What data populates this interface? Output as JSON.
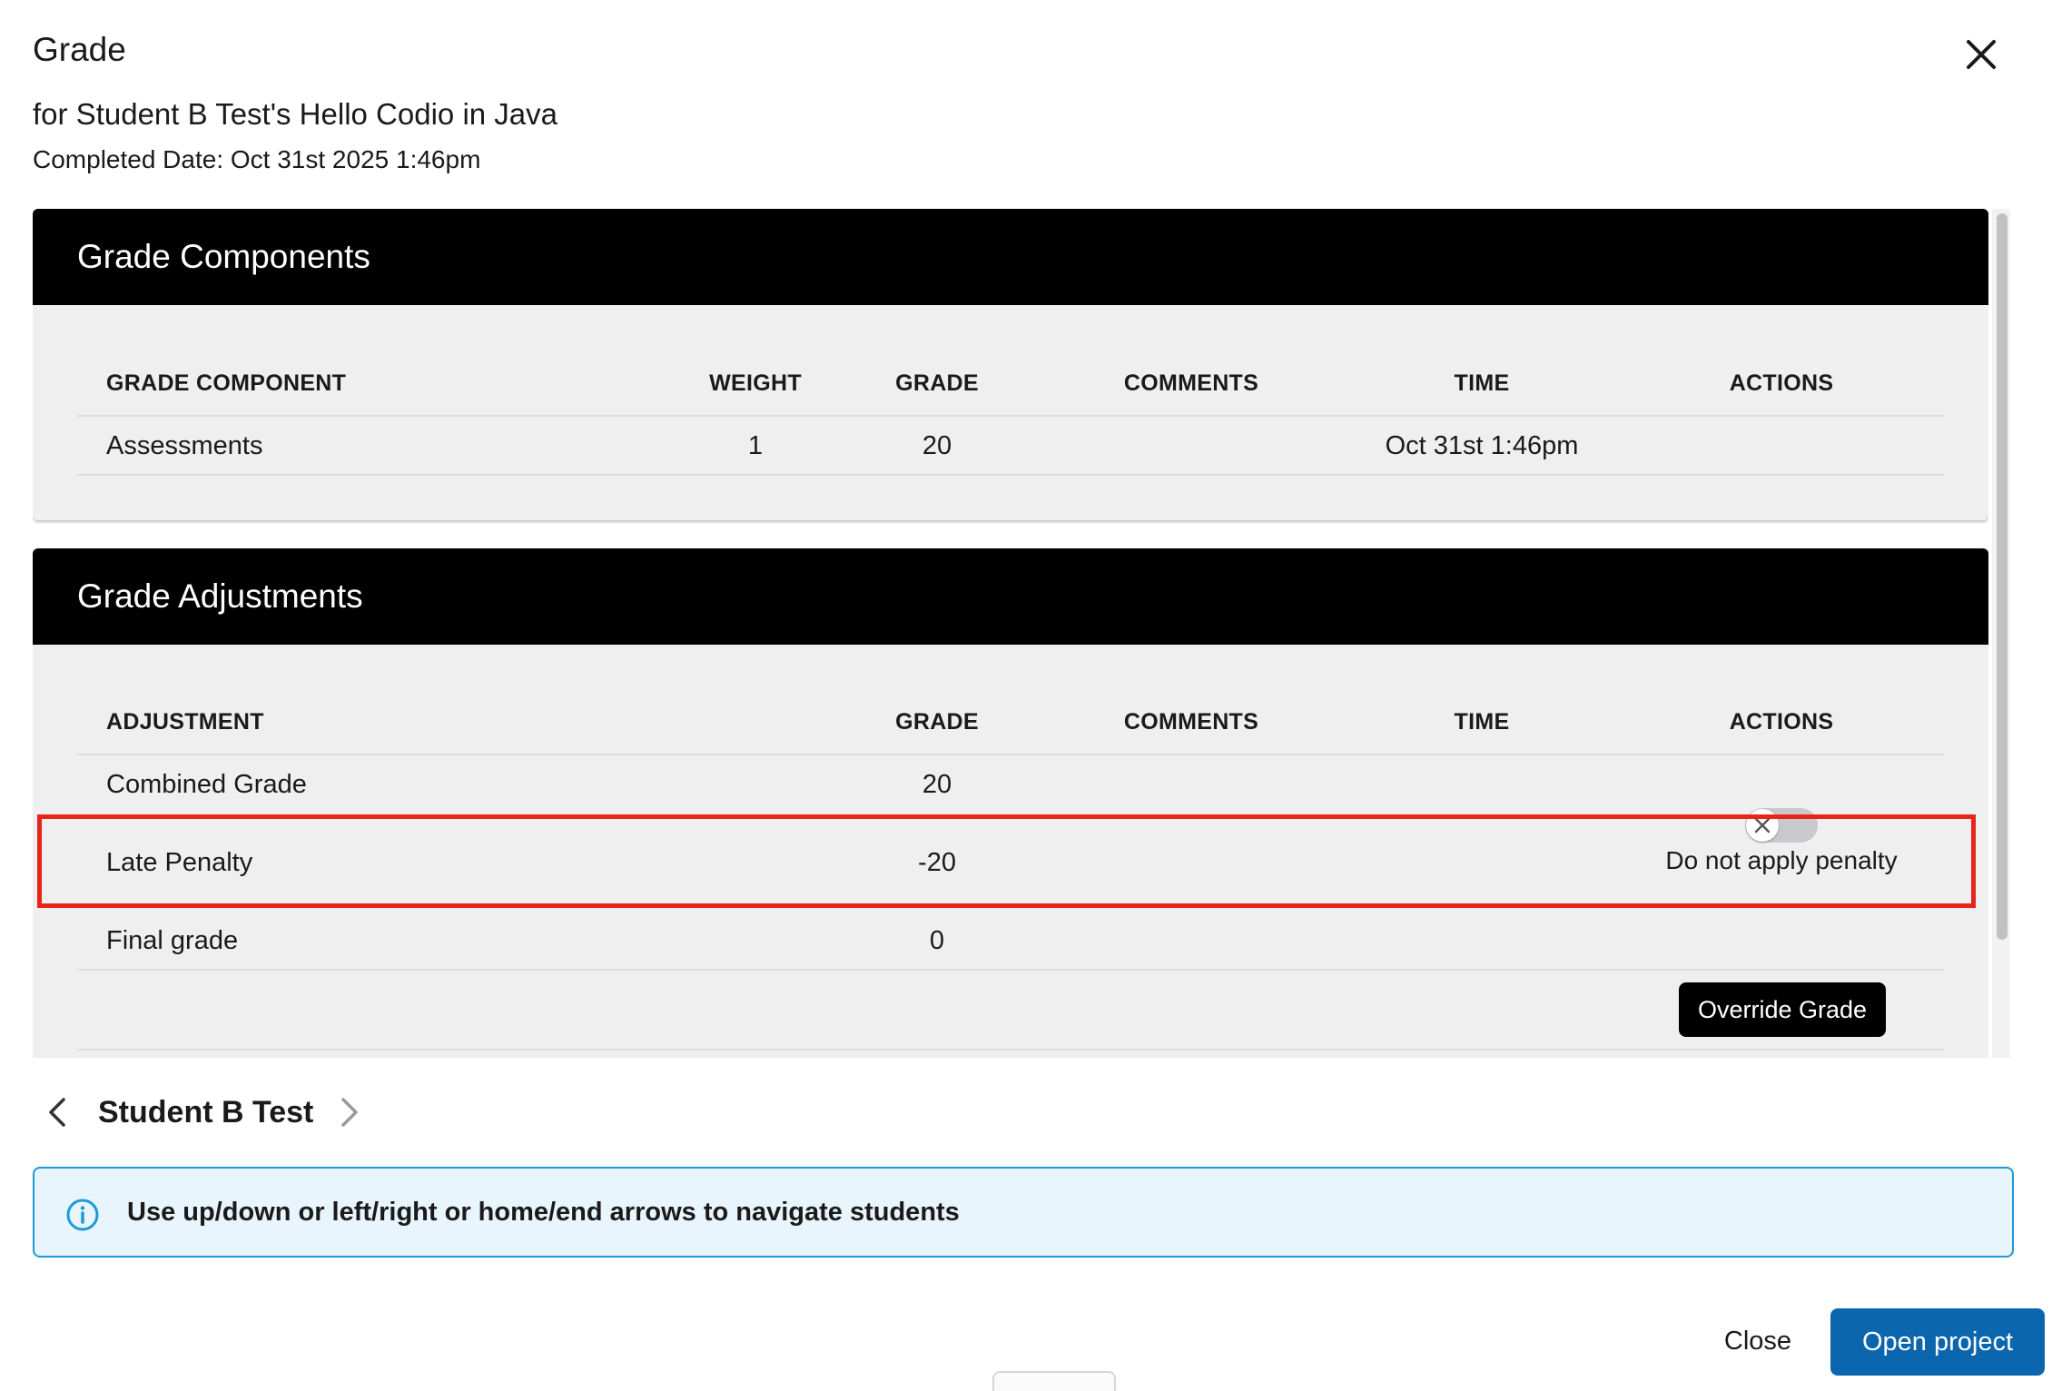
{
  "dialog": {
    "title": "Grade",
    "subtitle": "for Student B Test's Hello Codio in Java",
    "completed_date": "Completed Date: Oct 31st 2025 1:46pm"
  },
  "components": {
    "title": "Grade Components",
    "headers": {
      "component": "GRADE COMPONENT",
      "weight": "WEIGHT",
      "grade": "GRADE",
      "comments": "COMMENTS",
      "time": "TIME",
      "actions": "ACTIONS"
    },
    "rows": [
      {
        "name": "Assessments",
        "weight": "1",
        "grade": "20",
        "comments": "",
        "time": "Oct 31st 1:46pm"
      }
    ]
  },
  "adjustments": {
    "title": "Grade Adjustments",
    "headers": {
      "adjustment": "ADJUSTMENT",
      "grade": "GRADE",
      "comments": "COMMENTS",
      "time": "TIME",
      "actions": "ACTIONS"
    },
    "rows": [
      {
        "name": "Combined Grade",
        "grade": "20"
      },
      {
        "name": "Late Penalty",
        "grade": "-20",
        "action_label": "Do not apply penalty",
        "toggle_on": false
      },
      {
        "name": "Final grade",
        "grade": "0"
      }
    ],
    "override_label": "Override Grade"
  },
  "navigation": {
    "student_name": "Student B Test"
  },
  "info": {
    "message": "Use up/down or left/right or home/end arrows to navigate students"
  },
  "footer": {
    "close_label": "Close",
    "open_label": "Open project"
  },
  "colors": {
    "primary": "#0b66ad",
    "highlight": "#e8251a",
    "info_border": "#1e9ad6",
    "info_bg": "#e8f5fc",
    "header_bg": "#000000"
  }
}
